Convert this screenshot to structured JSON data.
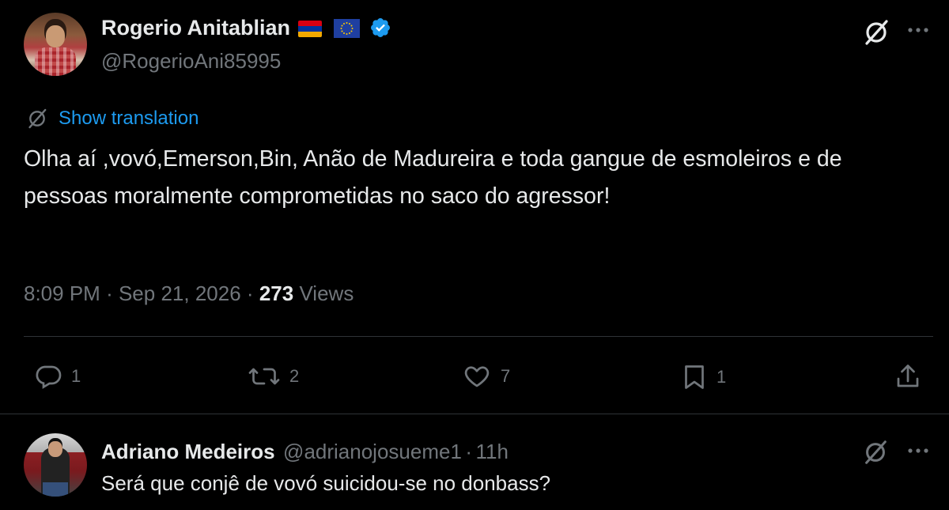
{
  "tweet": {
    "author_name": "Rogerio Anitablian",
    "author_handle": "@RogerioAni85995",
    "show_translation": "Show translation",
    "text": "Olha aí ,vovó,Emerson,Bin, Anão de Madureira e toda gangue de esmoleiros e de pessoas moralmente comprometidas no saco do agressor!",
    "time": "8:09 PM",
    "sep1": "·",
    "date": "Sep 21, 2026",
    "sep2": "·",
    "views_count": "273",
    "views_label": "Views",
    "replies": "1",
    "retweets": "2",
    "likes": "7",
    "bookmarks": "1"
  },
  "reply": {
    "author_name": "Adriano Medeiros",
    "author_handle": "@adrianojosueme1",
    "sep": "·",
    "age": "11h",
    "text": "Será  que conjê de vovó  suicidou-se no donbass?"
  },
  "icons": {
    "grok": "grok-icon",
    "more": "more-icon",
    "translate": "translate-icon",
    "reply": "reply-icon",
    "retweet": "retweet-icon",
    "like": "like-icon",
    "bookmark": "bookmark-icon",
    "share": "share-icon",
    "verified": "verified-badge-icon"
  },
  "colors": {
    "background": "#000000",
    "text": "#e7e9ea",
    "secondary": "#71767b",
    "link": "#1d9bf0",
    "divider": "#2f3336"
  }
}
